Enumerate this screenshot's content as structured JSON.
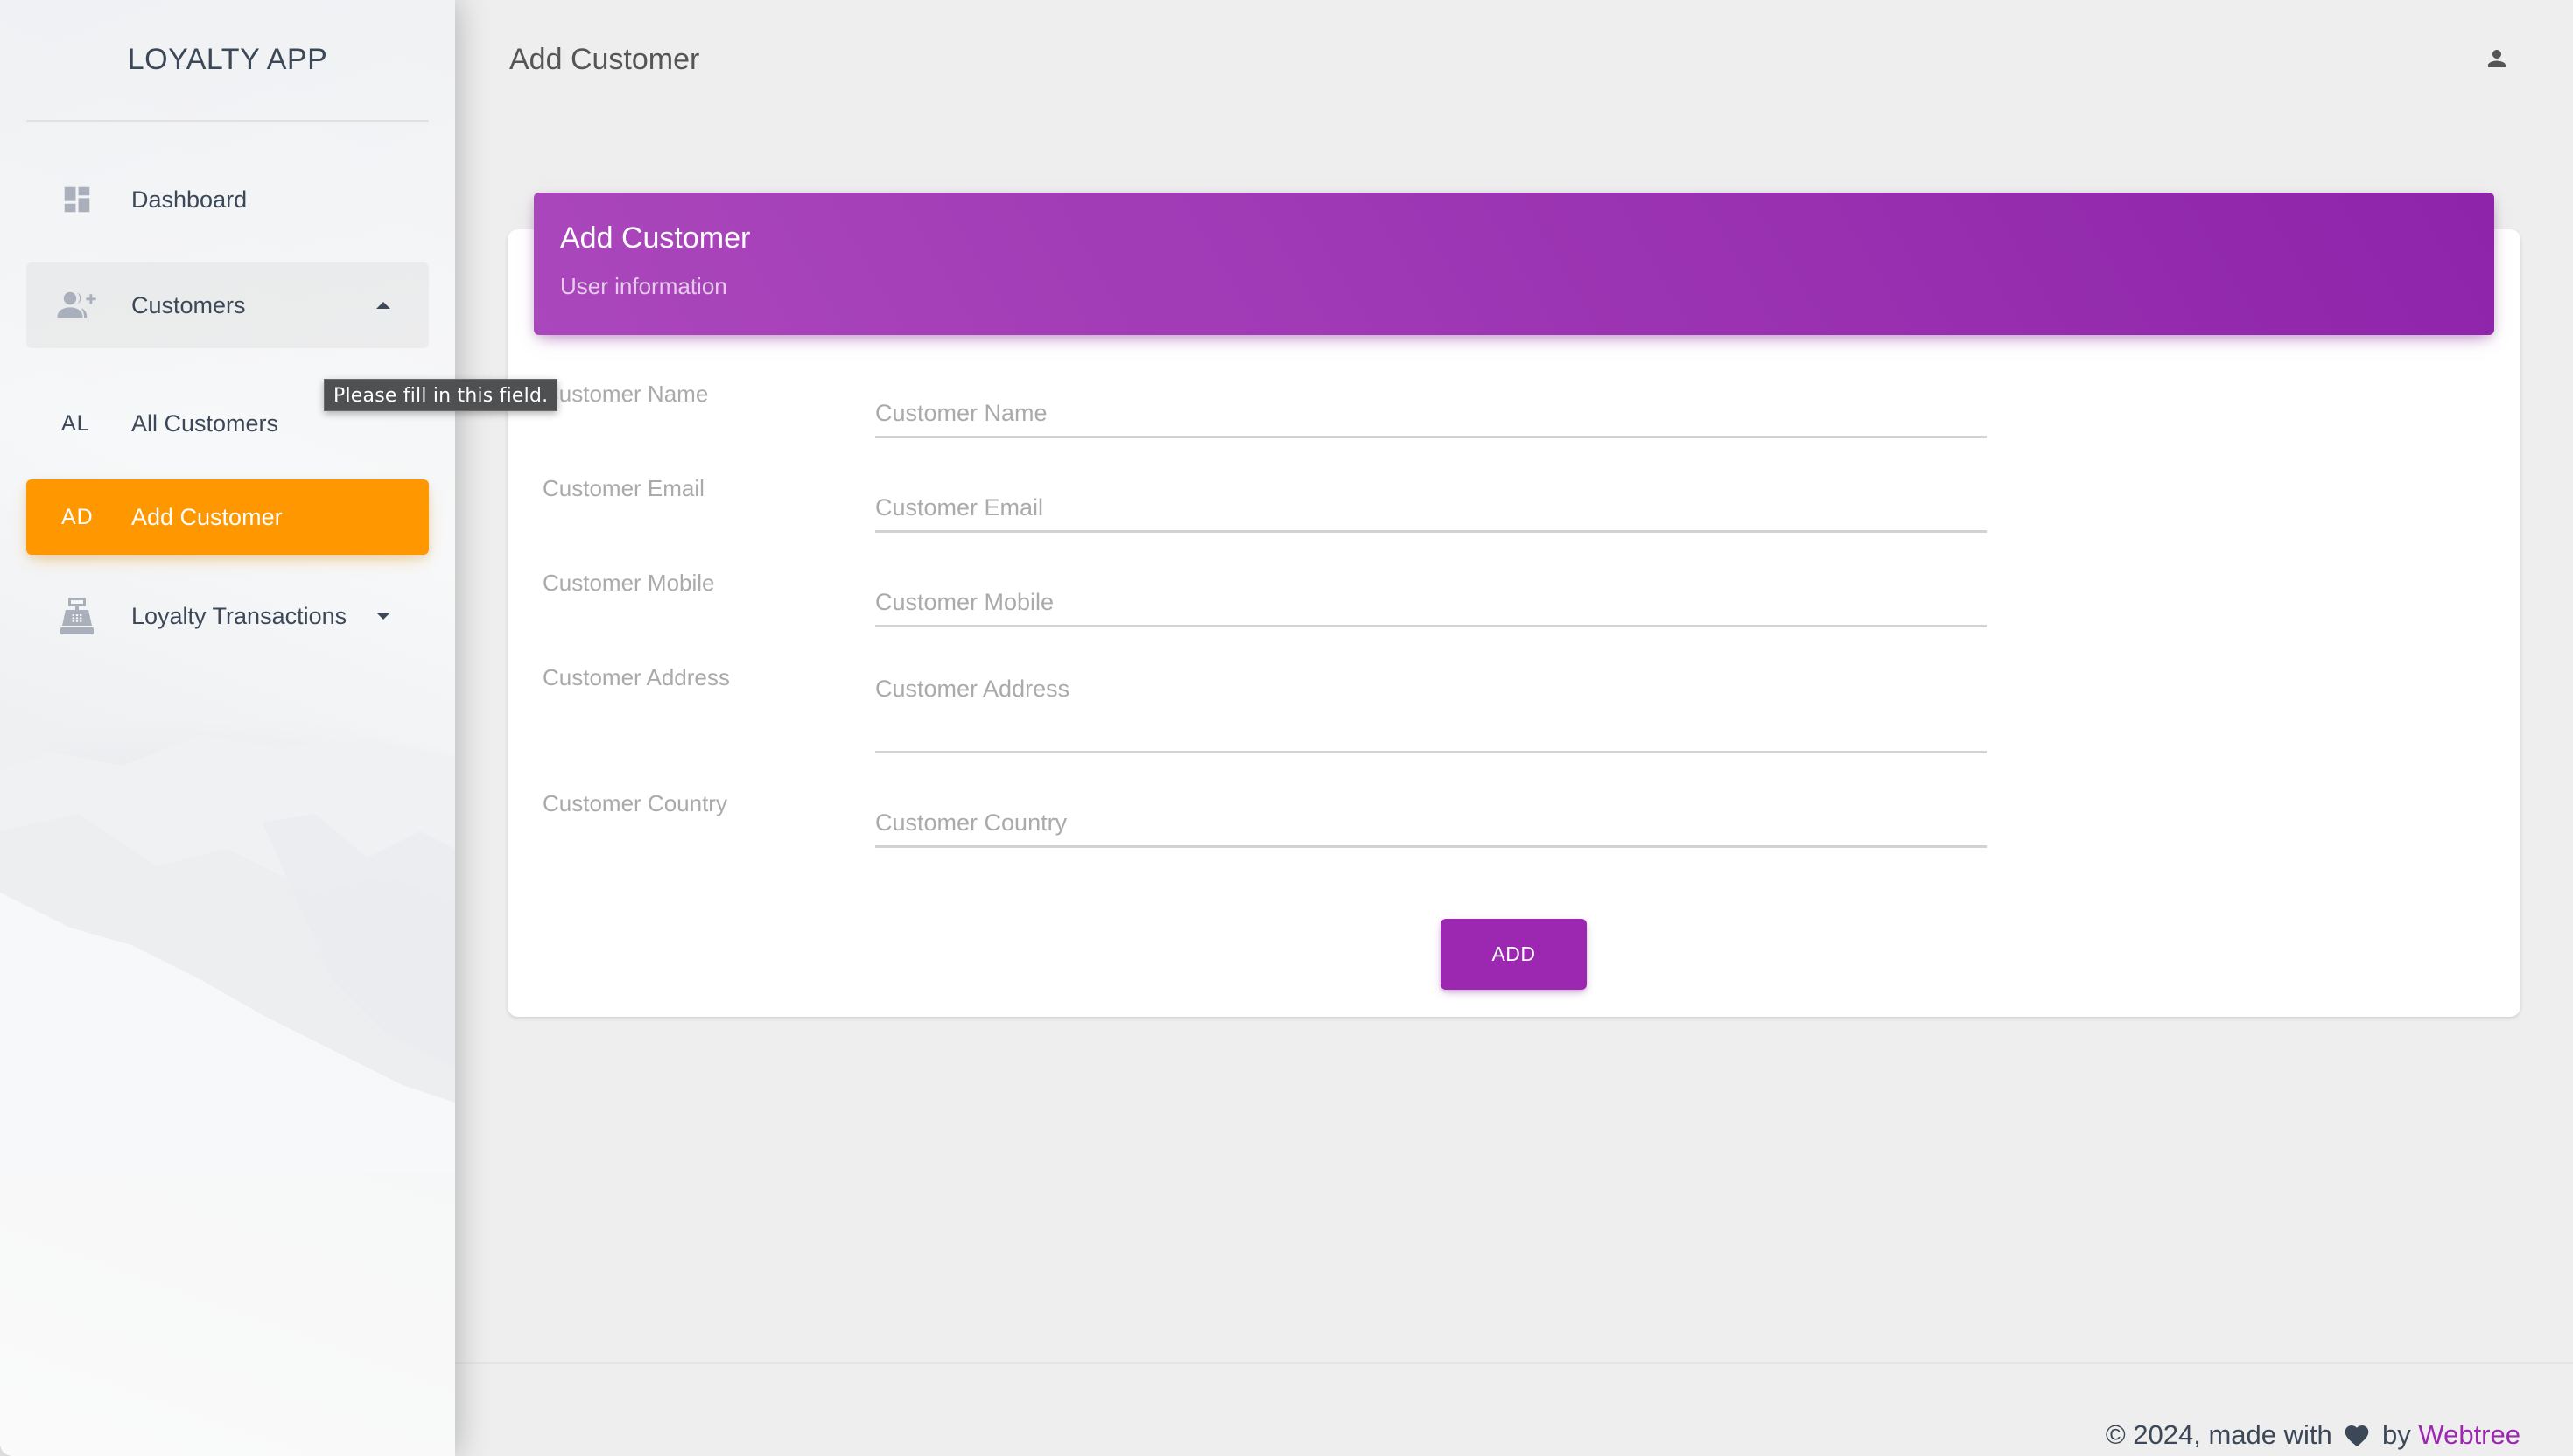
{
  "app": {
    "title": "LOYALTY APP"
  },
  "colors": {
    "primary": "#9c27b0",
    "active_nav": "#ff9800",
    "text": "#3c4858",
    "background": "#eeeeee"
  },
  "sidebar": {
    "items": [
      {
        "label": "Dashboard",
        "icon": "dashboard-icon"
      },
      {
        "label": "Customers",
        "icon": "group-add-icon",
        "expanded": true
      },
      {
        "abbr": "AL",
        "label": "All Customers"
      },
      {
        "abbr": "AD",
        "label": "Add Customer",
        "active": true
      },
      {
        "label": "Loyalty Transactions",
        "icon": "cash-register-icon",
        "expanded": false
      }
    ]
  },
  "topbar": {
    "title": "Add Customer",
    "user_icon": "person-icon"
  },
  "card": {
    "title": "Add Customer",
    "subtitle": "User information"
  },
  "form": {
    "fields": [
      {
        "label": "Customer Name",
        "placeholder": "Customer Name",
        "value": ""
      },
      {
        "label": "Customer Email",
        "placeholder": "Customer Email",
        "value": ""
      },
      {
        "label": "Customer Mobile",
        "placeholder": "Customer Mobile",
        "value": ""
      },
      {
        "label": "Customer Address",
        "placeholder": "Customer Address",
        "value": ""
      },
      {
        "label": "Customer Country",
        "placeholder": "Customer Country",
        "value": ""
      }
    ],
    "submit_label": "ADD"
  },
  "tooltip": {
    "text": "Please fill in this field."
  },
  "footer": {
    "prefix": "© 2024, made with",
    "by": "by",
    "link_text": "Webtree"
  }
}
